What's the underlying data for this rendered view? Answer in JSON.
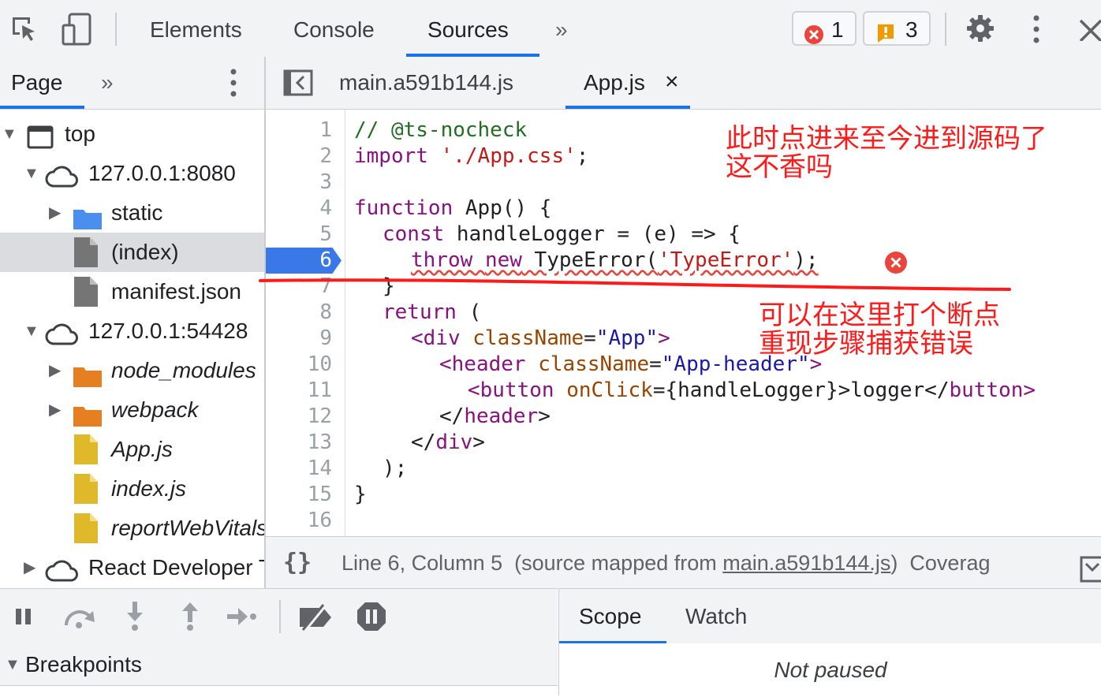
{
  "toolbar": {
    "tabs": [
      "Elements",
      "Console",
      "Sources"
    ],
    "active_tab": "Sources",
    "more": "»",
    "errors_count": "1",
    "warnings_count": "3"
  },
  "navigator": {
    "tab": "Page",
    "more": "»",
    "tree": [
      {
        "label": "top"
      },
      {
        "label": "127.0.0.1:8080"
      },
      {
        "label": "static"
      },
      {
        "label": "(index)"
      },
      {
        "label": "manifest.json"
      },
      {
        "label": "127.0.0.1:54428"
      },
      {
        "label": "node_modules"
      },
      {
        "label": "webpack"
      },
      {
        "label": "App.js"
      },
      {
        "label": "index.js"
      },
      {
        "label": "reportWebVitals.js"
      },
      {
        "label": "React Developer Tools"
      }
    ]
  },
  "editor": {
    "tabs": [
      {
        "label": "main.a591b144.js"
      },
      {
        "label": "App.js",
        "close": "×"
      }
    ],
    "line_numbers": [
      "1",
      "2",
      "3",
      "4",
      "5",
      "6",
      "7",
      "8",
      "9",
      "10",
      "11",
      "12",
      "13",
      "14",
      "15",
      "16"
    ],
    "breakpoint_line": "6",
    "code": {
      "l1": "// @ts-nocheck",
      "l2_kw": "import",
      "l2_str": "'./App.css'",
      "l2_end": ";",
      "l4_kw": "function",
      "l4_rest": " App() {",
      "l5_kw": "const",
      "l5_rest": " handleLogger = (e) => {",
      "l6_kw1": "throw",
      "l6_kw2": "new",
      "l6_fn": " TypeError(",
      "l6_str": "'TypeError'",
      "l6_end": ");",
      "l7": "}",
      "l8_kw": "return",
      "l8_rest": " (",
      "l9_open": "<div",
      "l9_attr": "className",
      "l9_eq": "=",
      "l9_val": "\"App\"",
      "l9_close": ">",
      "l10_open": "<header",
      "l10_attr": "className",
      "l10_eq": "=",
      "l10_val": "\"App-header\"",
      "l10_close": ">",
      "l11_open": "<button",
      "l11_attr": "onClick",
      "l11_rest": "={handleLogger}>logger</",
      "l11_tag": "button>",
      "l12_open": "</",
      "l12_tag": "header",
      "l12_close": ">",
      "l13_open": "</",
      "l13_tag": "div",
      "l13_close": ">",
      "l14": ");",
      "l15": "}"
    }
  },
  "status": {
    "position": "Line 6, Column 5",
    "source_prefix": "(source mapped from ",
    "source_file": "main.a591b144.js",
    "source_suffix": ")",
    "coverage": "Coverag"
  },
  "debugger": {
    "breakpoints_label": "Breakpoints"
  },
  "scope": {
    "tabs": [
      "Scope",
      "Watch"
    ],
    "message": "Not paused"
  },
  "annotations": {
    "top_line1": "此时点进来至今进到源码了",
    "top_line2": "这不香吗",
    "mid_line1": "可以在这里打个断点",
    "mid_line2": "重现步骤捕获错误"
  },
  "colors": {
    "accent": "#1a73e8",
    "annotation": "#ff1a1a",
    "error": "#e8453c",
    "warning": "#f29900"
  }
}
